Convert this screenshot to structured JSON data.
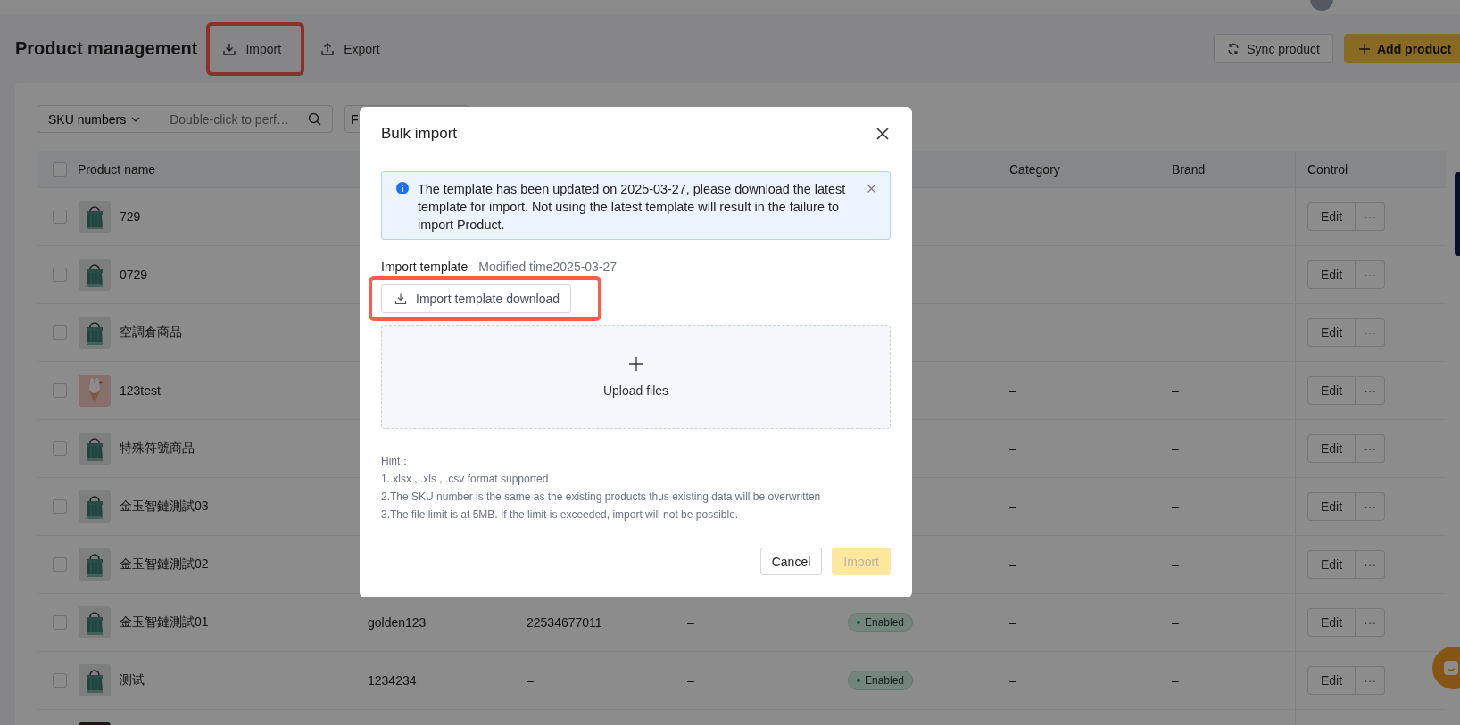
{
  "header": {
    "title": "Product management",
    "actions": [
      {
        "label": "Import",
        "highlighted": true
      },
      {
        "label": "Export",
        "highlighted": false
      }
    ],
    "buttons": [
      {
        "label": "Sync product",
        "kind": "secondary"
      },
      {
        "label": "Add product",
        "kind": "primary"
      }
    ]
  },
  "filters": {
    "field_select": "SKU numbers",
    "search": {
      "placeholder": "Double-click to perf…"
    },
    "select_2": "F"
  },
  "table": {
    "select_all": {
      "checked": false
    },
    "columns": [
      {
        "label": "Product name"
      },
      {
        "label": "Category"
      },
      {
        "label": "Brand"
      },
      {
        "label": "Control"
      }
    ],
    "rows": [
      {
        "checked": false,
        "name": "729",
        "category": "–",
        "brand": "–",
        "actions": [
          "Edit",
          "···"
        ]
      },
      {
        "checked": false,
        "name": "0729",
        "category": "–",
        "brand": "–",
        "actions": [
          "Edit",
          "···"
        ]
      },
      {
        "checked": false,
        "name": "空調倉商品",
        "category": "–",
        "brand": "–",
        "actions": [
          "Edit",
          "···"
        ]
      },
      {
        "checked": false,
        "name": "123test",
        "category": "–",
        "brand": "–",
        "actions": [
          "Edit",
          "···"
        ]
      },
      {
        "checked": false,
        "name": "特殊符號商品",
        "category": "–",
        "brand": "–",
        "actions": [
          "Edit",
          "···"
        ]
      },
      {
        "checked": false,
        "name": "金玉智鏈測試03",
        "category": "–",
        "brand": "–",
        "actions": [
          "Edit",
          "···"
        ]
      },
      {
        "checked": false,
        "name": "金玉智鏈測試02",
        "category": "–",
        "brand": "–",
        "actions": [
          "Edit",
          "···"
        ]
      },
      {
        "checked": false,
        "name": "金玉智鏈測試01",
        "column_2": "golden123",
        "column_3": "22534677011",
        "column_4": "–",
        "status": {
          "label": "Enabled",
          "kind": "enabled"
        },
        "category": "–",
        "brand": "–",
        "actions": [
          "Edit",
          "···"
        ]
      },
      {
        "checked": false,
        "name": "测试",
        "column_2": "1234234",
        "column_3": "–",
        "column_4": "–",
        "status": {
          "label": "Enabled",
          "kind": "enabled"
        },
        "category": "–",
        "brand": "–",
        "actions": [
          "Edit",
          "···"
        ]
      },
      {
        "kind": "picture"
      }
    ]
  },
  "modal": {
    "title": "Bulk import",
    "alert": {
      "text": "The template has been updated on 2025-03-27, please download the latest template for import. Not using the latest template will result in the failure to import Product."
    },
    "template": {
      "label": "Import template",
      "modified": "Modified time2025-03-27",
      "button": "Import template download",
      "highlighted": true
    },
    "upload": {
      "label": "Upload files"
    },
    "hint": {
      "title": "Hint：",
      "lines": [
        "1..xlsx , .xls , .csv format supported",
        "2.The SKU number is the same as the existing products thus existing data will be overwritten",
        "3.The file limit is at 5MB. If the limit is exceeded, import will not be possible."
      ]
    },
    "footer": [
      {
        "label": "Cancel",
        "kind": "default",
        "disabled": false
      },
      {
        "label": "Import",
        "kind": "primary",
        "disabled": true
      }
    ]
  }
}
